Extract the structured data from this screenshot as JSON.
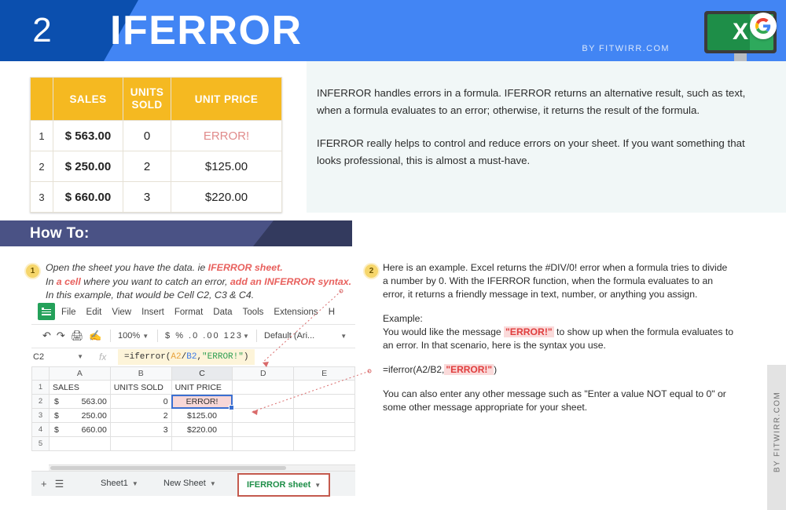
{
  "header": {
    "number": "2",
    "title": "IFERROR",
    "byline": "BY FITWIRR.COM",
    "excel_letter": "X",
    "accent_blue": "#4285F4",
    "accent_dark_blue": "#0B4FAE",
    "google_icon": "google-g-icon"
  },
  "intro": {
    "table": {
      "columns": [
        "",
        "SALES",
        "UNITS SOLD",
        "UNIT PRICE"
      ],
      "rows": [
        {
          "n": "1",
          "sales": "$ 563.00",
          "units": "0",
          "price": "ERROR!",
          "is_error": true
        },
        {
          "n": "2",
          "sales": "$ 250.00",
          "units": "2",
          "price": "$125.00",
          "is_error": false
        },
        {
          "n": "3",
          "sales": "$ 660.00",
          "units": "3",
          "price": "$220.00",
          "is_error": false
        }
      ],
      "header_color": "#F5B921",
      "error_color": "#E08B8B"
    },
    "paragraph1": "INFERROR handles errors in a formula. IFERROR returns an alternative result, such as text, when a formula evaluates to an error; otherwise, it returns the result of the formula.",
    "paragraph2": "IFERROR really helps to control and reduce errors on your sheet.  If you want something that looks professional, this is almost a must-have."
  },
  "howto": {
    "label": "How To:",
    "banner_color": "#4A5285"
  },
  "step1": {
    "badge": "1",
    "line1_a": "Open the sheet you have the data. ie ",
    "line1_b": "IFERROR sheet.",
    "line2_a": "In ",
    "line2_b": "a cell",
    "line2_c": " where you want to catch an error, ",
    "line2_d": "add an INFERROR syntax.",
    "line2_e": " In this example, that would be Cell C2, C3 & C4."
  },
  "sheet": {
    "logo": "google-sheets-icon",
    "menu": [
      "File",
      "Edit",
      "View",
      "Insert",
      "Format",
      "Data",
      "Tools",
      "Extensions",
      "H"
    ],
    "toolbar": {
      "undo_icon": "undo-icon",
      "redo_icon": "redo-icon",
      "print_icon": "print-icon",
      "paint_icon": "paint-format-icon",
      "zoom": "100%",
      "currency": "$",
      "percent": "%",
      "dec_decrease": ".0",
      "dec_increase": ".00",
      "number_format": "123",
      "font": "Default (Ari..."
    },
    "name_box": "C2",
    "fx_label": "fx",
    "formula": {
      "full": "=iferror(A2/B2,\"ERROR!\")",
      "part1": "=iferror(",
      "ref1": "A2",
      "slash": "/",
      "ref2": "B2",
      "comma": ",",
      "string": "\"ERROR!\"",
      "close": ")"
    },
    "grid": {
      "columns": [
        "A",
        "B",
        "C",
        "D",
        "E"
      ],
      "rows": [
        {
          "n": "1",
          "a": "SALES",
          "b": "UNITS SOLD",
          "c": "UNIT PRICE",
          "d": "",
          "e": ""
        },
        {
          "n": "2",
          "a": "563.00",
          "b": "0",
          "c": "ERROR!",
          "d": "",
          "e": "",
          "selected": true
        },
        {
          "n": "3",
          "a": "250.00",
          "b": "2",
          "c": "$125.00",
          "d": "",
          "e": ""
        },
        {
          "n": "4",
          "a": "660.00",
          "b": "3",
          "c": "$220.00",
          "d": "",
          "e": ""
        },
        {
          "n": "5",
          "a": "",
          "b": "",
          "c": "",
          "d": "",
          "e": ""
        }
      ]
    },
    "tabs": {
      "add_icon": "add-sheet-icon",
      "list_icon": "all-sheets-icon",
      "items": [
        "Sheet1",
        "New Sheet",
        "IFERROR sheet"
      ],
      "active": "IFERROR sheet",
      "active_color": "#1E8E48",
      "highlight_border": "#C45A4E"
    }
  },
  "step2": {
    "badge": "2",
    "paragraph1": "Here is an example. Excel returns the #DIV/0! error when a formula tries to divide a number by 0. With the IFERROR function, when the formula evaluates to an error, it returns a friendly message in text, number, or anything you assign.",
    "example_label": "Example:",
    "example_a": "You would like the message ",
    "example_hl": "\"ERROR!\"",
    "example_b": " to show up when the formula evaluates to an error. In that scenario, here is the syntax you use.",
    "syntax_a": "=iferror(A2/B2,",
    "syntax_hl": "\"ERROR!\"",
    "syntax_b": ")",
    "paragraph3": "You can also enter any other message such as \"Enter a value NOT equal to 0\" or some other message appropriate for your sheet."
  },
  "rail": {
    "text": "BY FITWIRR.COM"
  }
}
